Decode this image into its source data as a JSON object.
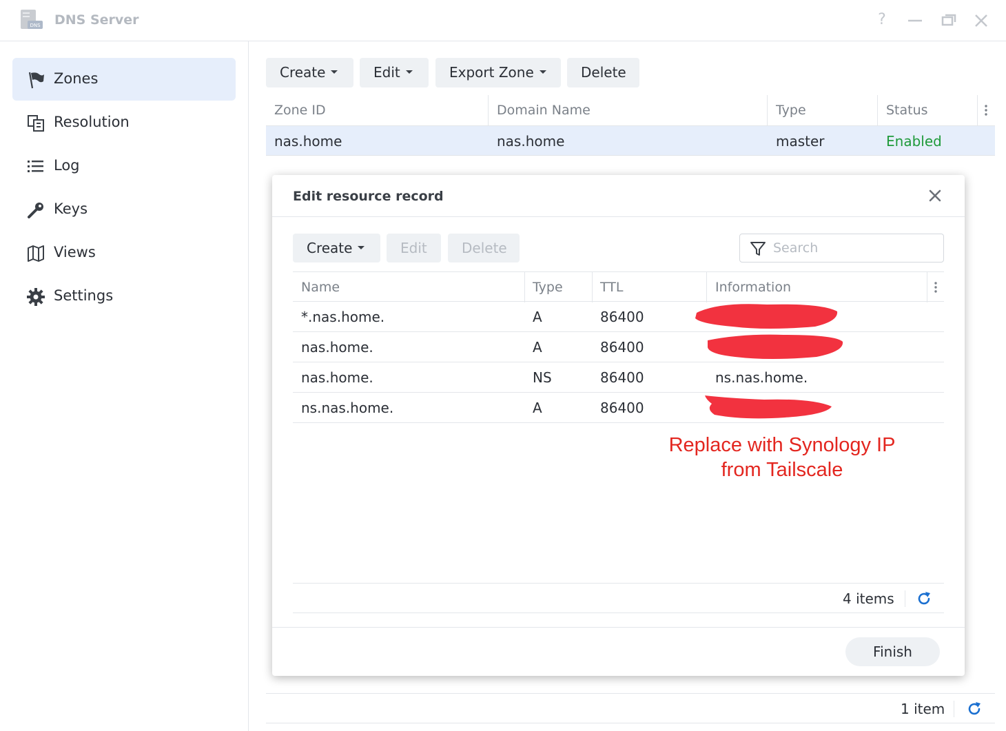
{
  "window": {
    "title": "DNS Server",
    "icon": "dns-server-app-icon",
    "icon_badge": "DNS",
    "controls": [
      "help-icon",
      "minimize-icon",
      "restore-icon",
      "close-icon"
    ]
  },
  "sidebar": {
    "items": [
      {
        "label": "Zones",
        "icon": "flag-icon",
        "active": true
      },
      {
        "label": "Resolution",
        "icon": "resolution-icon",
        "active": false
      },
      {
        "label": "Log",
        "icon": "list-icon",
        "active": false
      },
      {
        "label": "Keys",
        "icon": "key-icon",
        "active": false
      },
      {
        "label": "Views",
        "icon": "map-icon",
        "active": false
      },
      {
        "label": "Settings",
        "icon": "gear-icon",
        "active": false
      }
    ]
  },
  "toolbar": {
    "create": "Create",
    "edit": "Edit",
    "export_zone": "Export Zone",
    "delete": "Delete"
  },
  "zones_table": {
    "columns": [
      "Zone ID",
      "Domain Name",
      "Type",
      "Status"
    ],
    "rows": [
      {
        "zone_id": "nas.home",
        "domain_name": "nas.home",
        "type": "master",
        "status": "Enabled"
      }
    ],
    "count": "1 item"
  },
  "modal": {
    "title": "Edit resource record",
    "toolbar": {
      "create": "Create",
      "edit": "Edit",
      "delete": "Delete"
    },
    "search_placeholder": "Search",
    "columns": [
      "Name",
      "Type",
      "TTL",
      "Information"
    ],
    "rows": [
      {
        "name": "*.nas.home.",
        "type": "A",
        "ttl": "86400",
        "information": ""
      },
      {
        "name": "nas.home.",
        "type": "A",
        "ttl": "86400",
        "information": ""
      },
      {
        "name": "nas.home.",
        "type": "NS",
        "ttl": "86400",
        "information": "ns.nas.home."
      },
      {
        "name": "ns.nas.home.",
        "type": "A",
        "ttl": "86400",
        "information": ""
      }
    ],
    "annotation_line1": "Replace with Synology IP",
    "annotation_line2": "from Tailscale",
    "count": "4 items",
    "finish": "Finish"
  },
  "colors": {
    "accent": "#1a6fd0",
    "status_enabled": "#1f9a3a",
    "selected_row": "#e6eefb",
    "annotation": "#e3261f",
    "redaction": "#f2323f"
  }
}
